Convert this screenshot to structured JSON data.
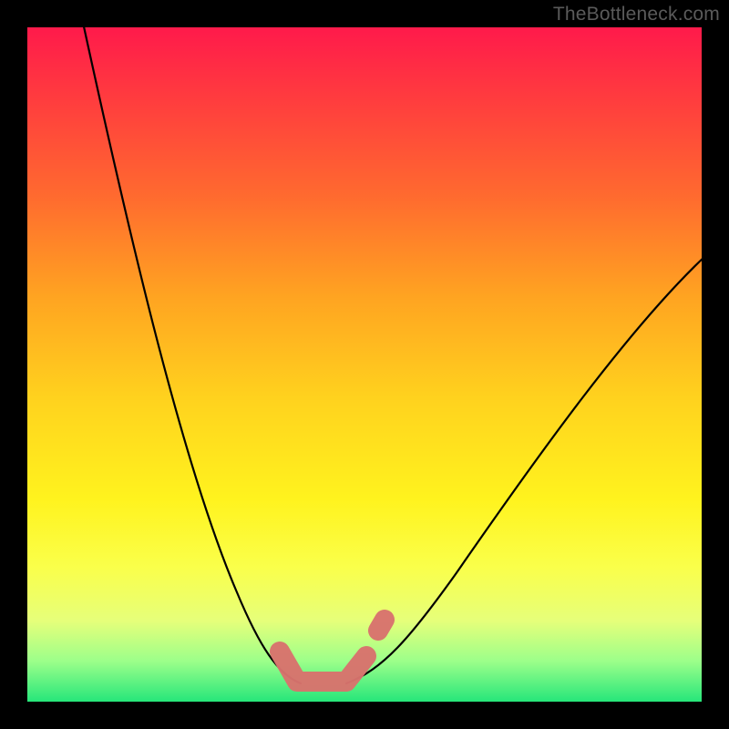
{
  "watermark": "TheBottleneck.com",
  "colors": {
    "gradient_top": "#ff1a4b",
    "gradient_mid": "#fff31e",
    "gradient_bottom": "#26e67a",
    "curve": "#000000",
    "marker": "#d8736d",
    "frame": "#000000",
    "watermark_text": "#5a5a5a"
  },
  "chart_data": {
    "type": "line",
    "title": "",
    "xlabel": "",
    "ylabel": "",
    "xlim": [
      0,
      100
    ],
    "ylim": [
      0,
      100
    ],
    "grid": false,
    "background": "vertical rainbow gradient (red top → yellow middle → green bottom) indicating bottleneck severity; green = balanced",
    "series": [
      {
        "name": "left-branch",
        "description": "bottleneck % descending from upper-left to valley",
        "x": [
          8,
          12,
          16,
          20,
          24,
          28,
          32,
          36,
          40
        ],
        "y": [
          100,
          84,
          68,
          52,
          37,
          24,
          14,
          6,
          2
        ]
      },
      {
        "name": "right-branch",
        "description": "bottleneck % rising from valley toward upper-right",
        "x": [
          47,
          52,
          58,
          64,
          72,
          80,
          90,
          100
        ],
        "y": [
          2,
          6,
          14,
          24,
          38,
          50,
          60,
          66
        ]
      }
    ],
    "annotations": [
      {
        "name": "valley-marker",
        "shape": "thick coral rounded stroke at valley floor",
        "approx_x_range": [
          36,
          53
        ],
        "approx_y_range": [
          0,
          10
        ]
      }
    ],
    "legend": false
  }
}
